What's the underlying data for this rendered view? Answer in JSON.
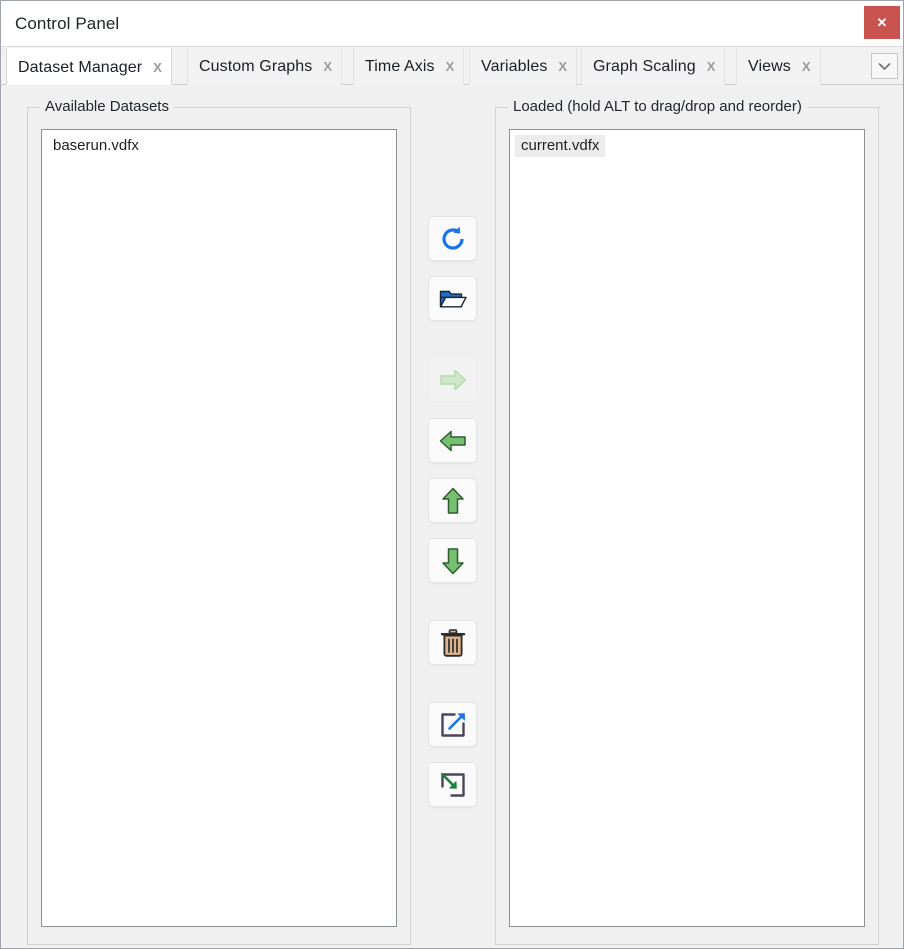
{
  "window": {
    "title": "Control Panel",
    "close_label": "✕",
    "close_icon": "close-icon",
    "close_color": "#c9544f"
  },
  "tabs": {
    "close_glyph": "X",
    "overflow_icon": "chevron-down-icon",
    "items": [
      {
        "label": "Dataset Manager",
        "selected": true
      },
      {
        "label": "Custom Graphs",
        "selected": false
      },
      {
        "label": "Time Axis",
        "selected": false
      },
      {
        "label": "Variables",
        "selected": false
      },
      {
        "label": "Graph Scaling",
        "selected": false
      },
      {
        "label": "Views",
        "selected": false
      }
    ]
  },
  "available_panel": {
    "title": "Available Datasets",
    "items": [
      {
        "name": "baserun.vdfx",
        "selected": false
      }
    ]
  },
  "loaded_panel": {
    "title": "Loaded (hold ALT to drag/drop and reorder)",
    "items": [
      {
        "name": "current.vdfx",
        "selected": true
      }
    ]
  },
  "buttons": [
    {
      "name": "refresh-button",
      "icon": "refresh-icon",
      "enabled": true,
      "color": "#1a73e8"
    },
    {
      "name": "open-folder-button",
      "icon": "folder-open-icon",
      "enabled": true,
      "color": "#1f6fd0"
    },
    {
      "name": "move-right-button",
      "icon": "arrow-right-icon",
      "enabled": false,
      "color": "#c9e6c4"
    },
    {
      "name": "move-left-button",
      "icon": "arrow-left-icon",
      "enabled": true,
      "color": "#6fbf6b"
    },
    {
      "name": "move-up-button",
      "icon": "arrow-up-icon",
      "enabled": true,
      "color": "#6fbf6b"
    },
    {
      "name": "move-down-button",
      "icon": "arrow-down-icon",
      "enabled": true,
      "color": "#6fbf6b"
    },
    {
      "name": "delete-button",
      "icon": "trash-icon",
      "enabled": true,
      "color": "#dcb48e"
    },
    {
      "name": "export-button",
      "icon": "export-icon",
      "enabled": true,
      "color": "#1a73e8"
    },
    {
      "name": "import-button",
      "icon": "import-icon",
      "enabled": true,
      "color": "#19853a"
    }
  ]
}
